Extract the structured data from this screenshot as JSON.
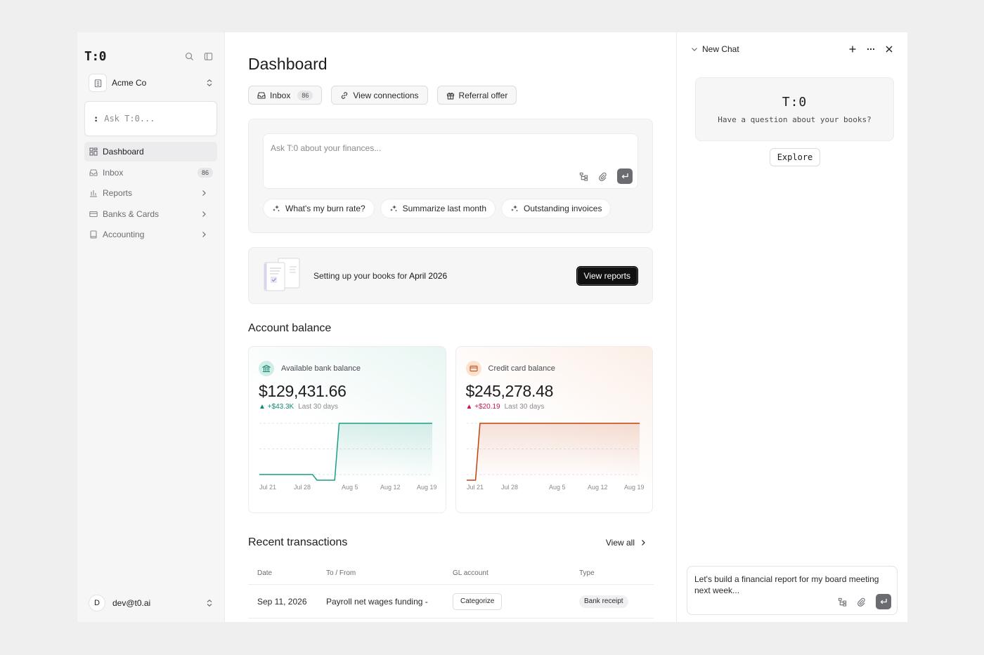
{
  "sidebar": {
    "logo": "T:0",
    "org_name": "Acme Co",
    "ask_prefix": ":",
    "ask_placeholder": "Ask T:0...",
    "nav": [
      {
        "label": "Dashboard",
        "icon": "grid-icon"
      },
      {
        "label": "Inbox",
        "icon": "inbox-icon",
        "count": "86"
      },
      {
        "label": "Reports",
        "icon": "bar-chart-icon"
      },
      {
        "label": "Banks & Cards",
        "icon": "card-icon"
      },
      {
        "label": "Accounting",
        "icon": "book-icon"
      }
    ],
    "user_initial": "D",
    "user_email": "dev@t0.ai"
  },
  "main": {
    "title": "Dashboard",
    "buttons": {
      "inbox_label": "Inbox",
      "inbox_count": "86",
      "connections_label": "View connections",
      "referral_label": "Referral offer"
    },
    "ask_placeholder": "Ask T:0 about your finances...",
    "suggestions": [
      "What's my burn rate?",
      "Summarize last month",
      "Outstanding invoices"
    ],
    "setup": {
      "text": "Setting up your books for",
      "month": "April 2026",
      "button": "View reports"
    },
    "balance_title": "Account balance",
    "bank": {
      "label": "Available bank balance",
      "amount": "$129,431.66",
      "delta": "+$43.3K",
      "period": "Last 30 days",
      "color": "#1a9e86"
    },
    "credit": {
      "label": "Credit card balance",
      "amount": "$245,278.48",
      "delta": "+$20.19",
      "period": "Last 30 days",
      "color": "#c2410c"
    },
    "transactions": {
      "title": "Recent transactions",
      "view_all": "View all",
      "columns": [
        "Date",
        "To / From",
        "GL account",
        "Type"
      ],
      "rows": [
        {
          "date": "Sep 11, 2026",
          "party": "Payroll net wages funding -",
          "gl_action": "Categorize",
          "type": "Bank receipt"
        }
      ]
    }
  },
  "chart_data": [
    {
      "type": "line",
      "x_ticks": [
        "Jul 21",
        "Jul 28",
        "Aug 5",
        "Aug 12",
        "Aug 19"
      ],
      "series": [
        {
          "values": [
            0.1,
            0.1,
            0.1,
            0.1,
            0.1,
            0.1,
            0.1,
            0.1,
            0.1,
            0.1,
            0.1,
            0.1,
            0.1,
            0.0,
            0.0,
            0.0,
            0.0,
            0.0,
            1.0,
            1.0,
            1.0,
            1.0,
            1.0,
            1.0,
            1.0,
            1.0,
            1.0,
            1.0,
            1.0,
            1.0,
            1.0,
            1.0,
            1.0,
            1.0,
            1.0,
            1.0,
            1.0,
            1.0,
            1.0,
            1.0
          ]
        }
      ],
      "grid": true
    },
    {
      "type": "line",
      "x_ticks": [
        "Jul 21",
        "Jul 28",
        "Aug 5",
        "Aug 12",
        "Aug 19"
      ],
      "series": [
        {
          "values": [
            0.0,
            0.0,
            0.0,
            1.0,
            1.0,
            1.0,
            1.0,
            1.0,
            1.0,
            1.0,
            1.0,
            1.0,
            1.0,
            1.0,
            1.0,
            1.0,
            1.0,
            1.0,
            1.0,
            1.0,
            1.0,
            1.0,
            1.0,
            1.0,
            1.0,
            1.0,
            1.0,
            1.0,
            1.0,
            1.0,
            1.0,
            1.0,
            1.0,
            1.0,
            1.0,
            1.0,
            1.0,
            1.0,
            1.0,
            1.0
          ]
        }
      ],
      "grid": true
    }
  ],
  "chat": {
    "title": "New Chat",
    "logo": "T:0",
    "question": "Have a question about your books?",
    "explore": "Explore",
    "input_text": "Let's build a financial report for my board meeting next week..."
  }
}
